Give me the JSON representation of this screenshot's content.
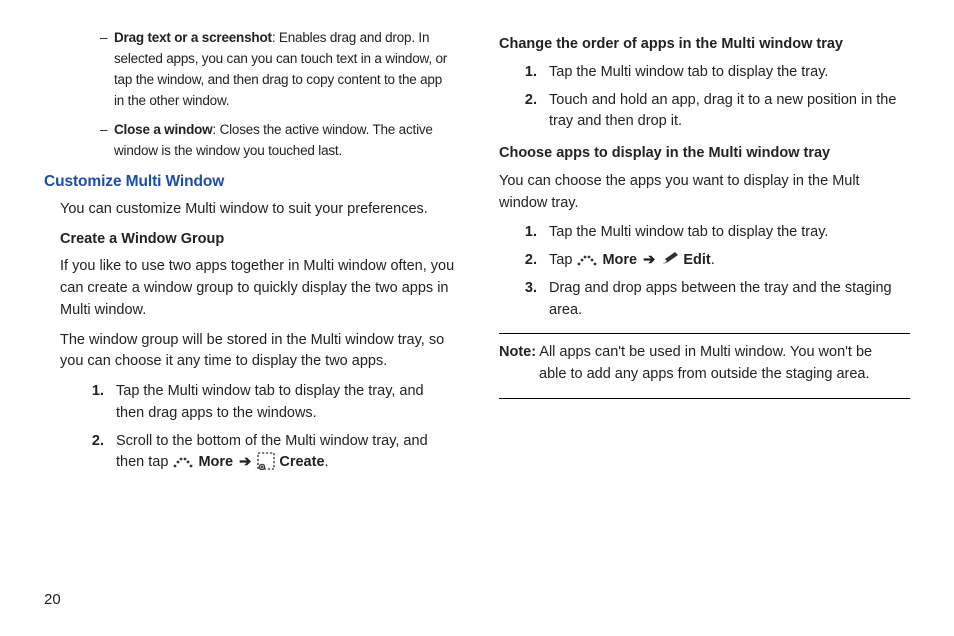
{
  "col1": {
    "dash_items": [
      {
        "title": "Drag text or a screenshot",
        "text": ": Enables drag and drop. In selected apps, you can you can touch text in a window, or tap the window, and then drag to copy content to the app in the other window."
      },
      {
        "title": "Close a window",
        "text": ": Closes the active window. The active window is the window you touched last."
      }
    ],
    "section_title": "Customize Multi Window",
    "intro": "You can customize Multi window to suit your preferences.",
    "sub1_title": "Create a Window Group",
    "sub1_p1": "If you like to use two apps together in Multi window often, you can create a window group to quickly display the two apps in Multi window.",
    "sub1_p2": "The window group will be stored in the Multi window tray, so you can choose it any time to display the two apps.",
    "sub1_steps": [
      "Tap the Multi window tab to display the tray, and then drag apps to the windows.",
      "Scroll to the bottom of the Multi window tray, and then tap "
    ],
    "more_label": "More",
    "create_label": "Create",
    "arrow": "➔"
  },
  "col2": {
    "sub2_title": "Change the order of apps in the Multi window tray",
    "sub2_steps": [
      "Tap the Multi window tab to display the tray.",
      "Touch and hold an app, drag it to a new position in the tray and then drop it."
    ],
    "sub3_title": "Choose apps to display in the Multi window tray",
    "sub3_intro": "You can choose the apps you want to display in the Mult window tray.",
    "sub3_steps_1": "Tap the Multi window tab to display the tray.",
    "sub3_steps_2_pre": "Tap ",
    "more_label": "More",
    "edit_label": "Edit",
    "arrow": "➔",
    "sub3_steps_3": "Drag and drop apps between the tray and the staging area.",
    "note_label": "Note:",
    "note_first": " All apps can't be used in Multi window. You won't be",
    "note_rest": "able to add any apps from outside the staging area."
  },
  "page_number": "20",
  "dot": "."
}
